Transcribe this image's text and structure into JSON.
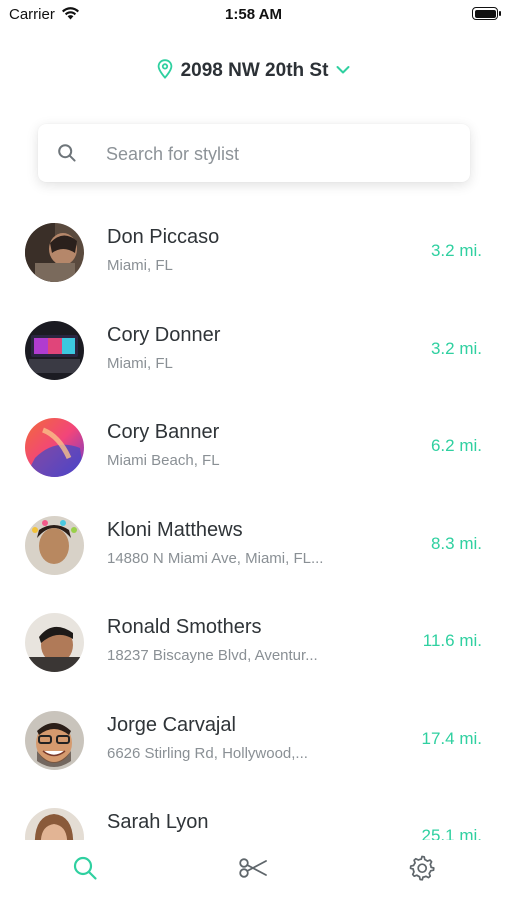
{
  "status_bar": {
    "carrier": "Carrier",
    "time": "1:58 AM"
  },
  "location": {
    "address": "2098 NW 20th St"
  },
  "search": {
    "placeholder": "Search for stylist"
  },
  "colors": {
    "accent": "#2fd0a0",
    "text": "#2f3438",
    "subtext": "#8a9095"
  },
  "stylists": [
    {
      "name": "Don Piccaso",
      "location": "Miami, FL",
      "distance": "3.2 mi."
    },
    {
      "name": "Cory Donner",
      "location": "Miami, FL",
      "distance": "3.2 mi."
    },
    {
      "name": "Cory Banner",
      "location": "Miami Beach, FL",
      "distance": "6.2 mi."
    },
    {
      "name": "Kloni Matthews",
      "location": "14880 N Miami Ave, Miami, FL...",
      "distance": "8.3 mi."
    },
    {
      "name": "Ronald Smothers",
      "location": "18237 Biscayne Blvd, Aventur...",
      "distance": "11.6 mi."
    },
    {
      "name": "Jorge Carvajal",
      "location": "6626 Stirling Rd, Hollywood,...",
      "distance": "17.4 mi."
    },
    {
      "name": "Sarah Lyon",
      "location": "",
      "distance": "25.1 mi."
    }
  ],
  "tabs": [
    {
      "icon": "search-icon",
      "active": true
    },
    {
      "icon": "scissors-icon",
      "active": false
    },
    {
      "icon": "gear-icon",
      "active": false
    }
  ]
}
